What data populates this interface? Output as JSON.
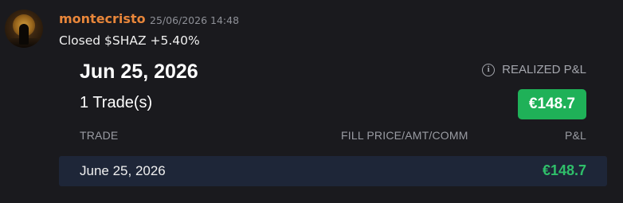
{
  "message": {
    "author": "montecristo",
    "timestamp": "25/06/2026 14:48",
    "content": "Closed $SHAZ +5.40%"
  },
  "card": {
    "date": "Jun 25, 2026",
    "realized_label": "REALIZED P&L",
    "info_icon": "info-icon",
    "trade_count": "1 Trade(s)",
    "pnl_badge": "€148.7",
    "columns": {
      "trade": "TRADE",
      "fill": "FILL PRICE/AMT/COMM",
      "pnl": "P&L"
    },
    "rows": [
      {
        "date": "June 25, 2026",
        "pnl": "€148.7"
      }
    ]
  },
  "colors": {
    "author": "#e8863a",
    "pnl_badge_bg": "#1fb158",
    "row_pnl": "#2fbf6a",
    "row_bg": "#1e2638",
    "background": "#1a1a1e"
  }
}
